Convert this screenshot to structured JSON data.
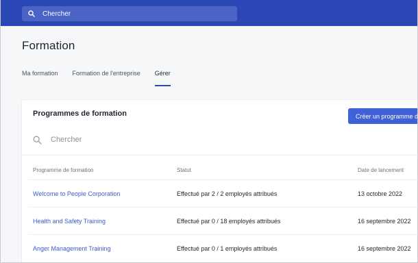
{
  "topbar": {
    "search_placeholder": "Chercher",
    "search_icon": "search-icon"
  },
  "page": {
    "title": "Formation"
  },
  "tabs": [
    {
      "label": "Ma formation",
      "active": false
    },
    {
      "label": "Formation de l'entreprise",
      "active": false
    },
    {
      "label": "Gérer",
      "active": true
    }
  ],
  "card": {
    "title": "Programmes de formation",
    "create_button": "Créer un programme de formation",
    "search_placeholder": "Chercher",
    "columns": [
      "Programme de formation",
      "Statut",
      "Date de lancement"
    ],
    "rows": [
      {
        "program": "Welcome to People Corporation",
        "status": "Effectué par 2 / 2 employés attribués",
        "date": "13 octobre 2022"
      },
      {
        "program": "Health and Safety Training",
        "status": "Effectué par 0 / 18 employés attribués",
        "date": "16 septembre 2022"
      },
      {
        "program": "Anger Management Training",
        "status": "Effectué par 0 / 1 employés attribués",
        "date": "16 septembre 2022"
      }
    ]
  },
  "colors": {
    "brand": "#2b46b5",
    "button": "#4162d6",
    "link": "#3b5ccc"
  }
}
